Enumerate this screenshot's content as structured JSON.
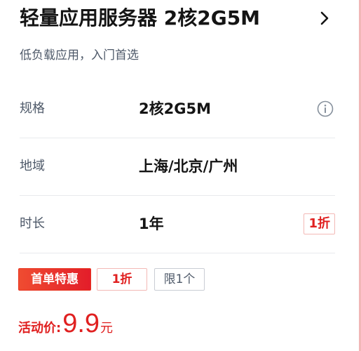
{
  "product": {
    "title": "轻量应用服务器 2核2G5M",
    "subtitle": "低负载应用，入门首选"
  },
  "specs": [
    {
      "label": "规格",
      "value": "2核2G5M"
    },
    {
      "label": "地域",
      "value": "上海/北京/广州"
    },
    {
      "label": "时长",
      "value": "1年",
      "badge": "1折"
    }
  ],
  "tags": {
    "promo": "首单特惠",
    "discount": "1折",
    "limit": "限1个"
  },
  "price": {
    "label": "活动价:",
    "value": "9.9",
    "unit": "元"
  },
  "icons": {
    "header_arrow": "chevron-right-icon",
    "spec_info": "info-icon"
  },
  "colors": {
    "accent_red": "#e02020",
    "promo_gradient_start": "#ef4c31",
    "promo_gradient_end": "#e31d2a",
    "text_primary": "#141414",
    "text_secondary": "#4e5969",
    "divider": "#e8eaed"
  }
}
